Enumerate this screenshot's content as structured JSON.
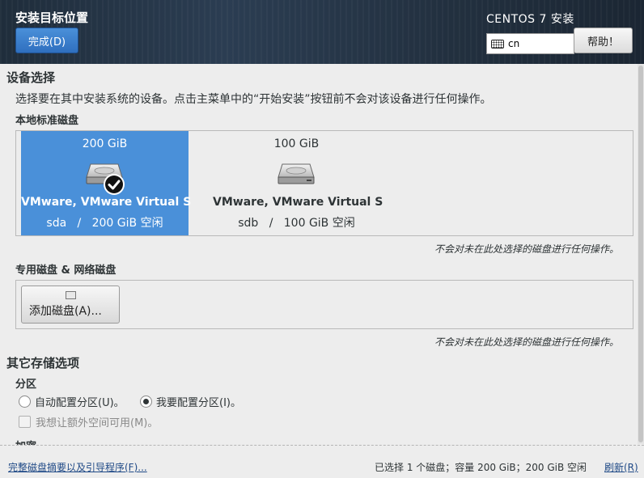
{
  "header": {
    "title": "安装目标位置",
    "done_label": "完成(D)",
    "product": "CENTOS 7 安装",
    "keyboard_layout": "cn",
    "help_label": "帮助！"
  },
  "device_selection": {
    "title": "设备选择",
    "description": "选择要在其中安装系统的设备。点击主菜单中的“开始安装”按钮前不会对该设备进行任何操作。",
    "local_disks_label": "本地标准磁盘",
    "disks": [
      {
        "size": "200 GiB",
        "name": "VMware, VMware Virtual S",
        "device": "sda",
        "sep": "/",
        "free": "200 GiB 空闲",
        "selected": true
      },
      {
        "size": "100 GiB",
        "name": "VMware, VMware Virtual S",
        "device": "sdb",
        "sep": "/",
        "free": "100 GiB 空闲",
        "selected": false
      }
    ],
    "local_note": "不会对未在此处选择的磁盘进行任何操作。",
    "special_label": "专用磁盘 & 网络磁盘",
    "add_disk_label": "添加磁盘(A)...",
    "special_note": "不会对未在此处选择的磁盘进行任何操作。"
  },
  "other_options": {
    "title": "其它存储选项",
    "partition_label": "分区",
    "auto_partition": "自动配置分区(U)。",
    "manual_partition": "我要配置分区(I)。",
    "manual_selected": true,
    "extra_space": "我想让额外空间可用(M)。",
    "encryption_label": "加密"
  },
  "footer": {
    "summary_link": "完整磁盘摘要以及引导程序(F)...",
    "status": "已选择 1 个磁盘；容量 200 GiB；200 GiB 空闲",
    "refresh_link": "刷新(R)"
  },
  "colors": {
    "selected": "#4a90d9",
    "header": "#22303f",
    "link": "#204a87"
  }
}
